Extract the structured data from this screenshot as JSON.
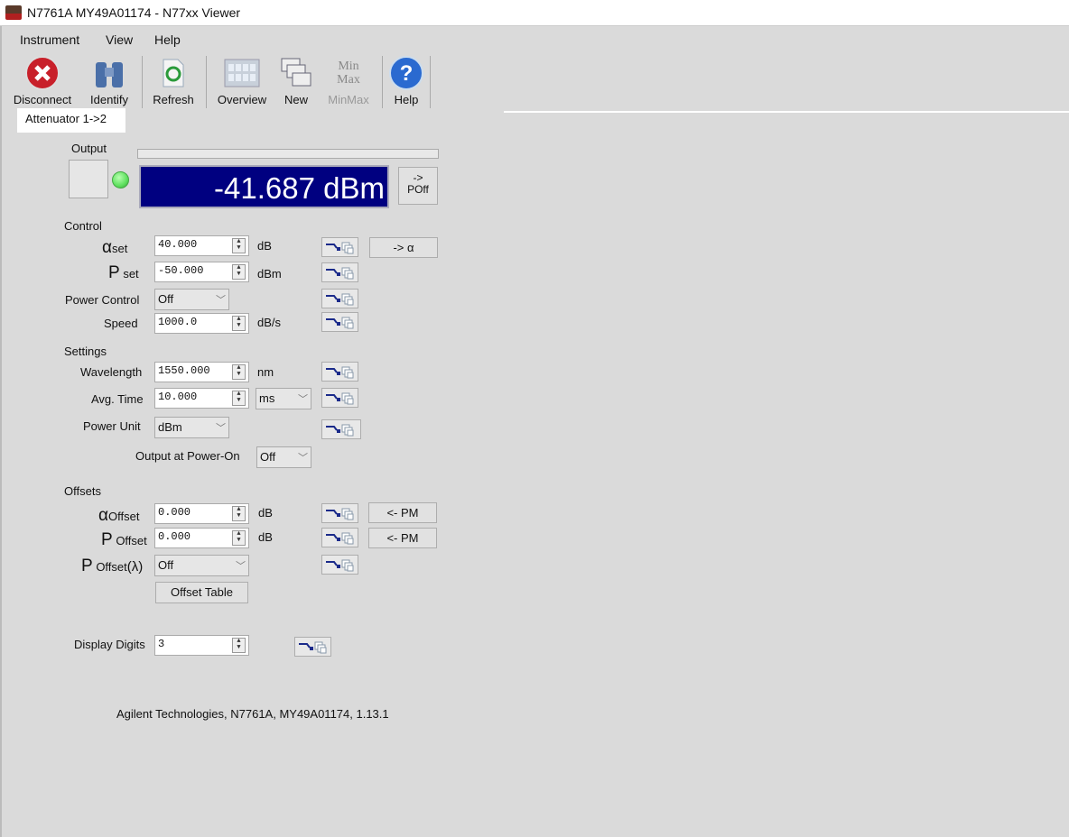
{
  "window": {
    "title": "N7761A MY49A01174 - N77xx Viewer"
  },
  "menu": [
    "Instrument",
    "View",
    "Help"
  ],
  "toolbar": [
    {
      "label": "Disconnect",
      "icon": "disconnect-icon"
    },
    {
      "label": "Identify",
      "icon": "binoculars-icon"
    },
    {
      "label": "Refresh",
      "icon": "refresh-icon"
    },
    {
      "label": "Overview",
      "icon": "overview-grid-icon"
    },
    {
      "label": "New",
      "icon": "new-windows-icon"
    },
    {
      "label": "MinMax",
      "icon": "minmax-icon",
      "icon_text": "Min Max",
      "disabled": true
    },
    {
      "label": "Help",
      "icon": "help-icon"
    }
  ],
  "tab": "Attenuator 1->2",
  "output": {
    "label": "Output",
    "reading": "-41.687 dBm",
    "poff_arrow": "->",
    "poff": "POff",
    "led_color": "#5ee05e",
    "display_bg": "#000080"
  },
  "control": {
    "heading": "Control",
    "alpha_set": {
      "sym": "α",
      "sub": "set",
      "value": "40.000",
      "unit": "dB",
      "to_alpha": "-> α"
    },
    "p_set": {
      "sym": "P",
      "sub": "set",
      "value": "-50.000",
      "unit": "dBm"
    },
    "power_control": {
      "label": "Power Control",
      "value": "Off"
    },
    "speed": {
      "label": "Speed",
      "value": "1000.0",
      "unit": "dB/s"
    }
  },
  "settings": {
    "heading": "Settings",
    "wavelength": {
      "label": "Wavelength",
      "value": "1550.000",
      "unit": "nm"
    },
    "avg_time": {
      "label": "Avg. Time",
      "value": "10.000",
      "unit": "ms"
    },
    "power_unit": {
      "label": "Power Unit",
      "value": "dBm"
    },
    "power_on": {
      "label": "Output at Power-On",
      "value": "Off"
    }
  },
  "offsets": {
    "heading": "Offsets",
    "alpha_offset": {
      "sym": "α",
      "sub": "Offset",
      "value": "0.000",
      "unit": "dB",
      "pm": "<- PM"
    },
    "p_offset": {
      "sym": "P",
      "sub": "Offset",
      "value": "0.000",
      "unit": "dB",
      "pm": "<- PM"
    },
    "p_offset_lambda": {
      "sym": "P",
      "sub": "Offset",
      "suffix": "(λ)",
      "value": "Off"
    },
    "table_button": "Offset Table"
  },
  "display_digits": {
    "label": "Display Digits",
    "value": "3"
  },
  "footer": "Agilent Technologies, N7761A, MY49A01174, 1.13.1"
}
